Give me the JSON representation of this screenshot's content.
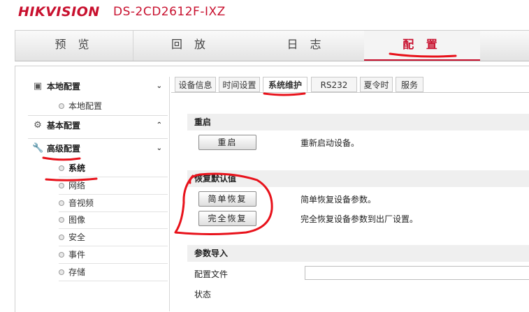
{
  "header": {
    "logo": "HIKVISION",
    "model": "DS-2CD2612F-IXZ"
  },
  "topnav": [
    {
      "label": "预 览",
      "active": false
    },
    {
      "label": "回 放",
      "active": false
    },
    {
      "label": "日 志",
      "active": false
    },
    {
      "label": "配 置",
      "active": true
    }
  ],
  "sidebar": {
    "groups": [
      {
        "label": "本地配置",
        "icon": "monitor-icon",
        "chevron": "⌄",
        "expanded": true,
        "items": [
          {
            "label": "本地配置",
            "active": false
          }
        ]
      },
      {
        "label": "基本配置",
        "icon": "gear-icon",
        "chevron": "⌃",
        "expanded": false,
        "items": []
      },
      {
        "label": "高级配置",
        "icon": "wrench-icon",
        "chevron": "⌄",
        "expanded": true,
        "items": [
          {
            "label": "系统",
            "active": true
          },
          {
            "label": "网络",
            "active": false
          },
          {
            "label": "音视频",
            "active": false
          },
          {
            "label": "图像",
            "active": false
          },
          {
            "label": "安全",
            "active": false
          },
          {
            "label": "事件",
            "active": false
          },
          {
            "label": "存储",
            "active": false
          }
        ]
      }
    ]
  },
  "subtabs": [
    {
      "label": "设备信息",
      "active": false
    },
    {
      "label": "时间设置",
      "active": false
    },
    {
      "label": "系统维护",
      "active": true
    },
    {
      "label": "RS232",
      "active": false
    },
    {
      "label": "夏令时",
      "active": false
    },
    {
      "label": "服务",
      "active": false
    }
  ],
  "sections": {
    "reboot": {
      "title": "重启",
      "button": "重启",
      "desc": "重新启动设备。"
    },
    "restore": {
      "title": "恢复默认值",
      "simple_button": "简单恢复",
      "simple_desc": "简单恢复设备参数。",
      "full_button": "完全恢复",
      "full_desc": "完全恢复设备参数到出厂设置。"
    },
    "import": {
      "title": "参数导入",
      "config_label": "配置文件",
      "config_value": "",
      "status_label": "状态"
    }
  },
  "colors": {
    "brand": "#c8102e",
    "annotation": "#e8121b"
  }
}
